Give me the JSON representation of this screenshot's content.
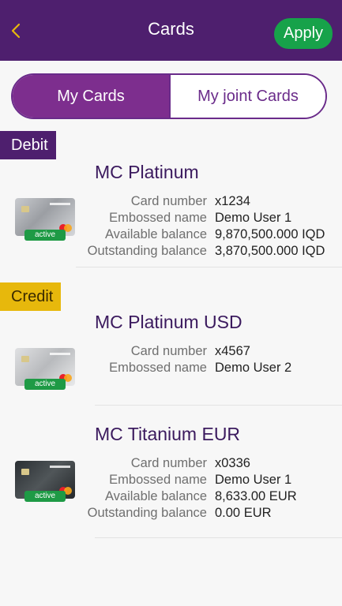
{
  "header": {
    "title": "Cards",
    "apply_label": "Apply"
  },
  "tabs": [
    {
      "label": "My Cards",
      "active": true
    },
    {
      "label": "My joint Cards",
      "active": false
    }
  ],
  "sections": {
    "debit_label": "Debit",
    "credit_label": "Credit"
  },
  "cards": [
    {
      "name": "MC Platinum",
      "status": "active",
      "fields": [
        {
          "label": "Card number",
          "value": "x1234"
        },
        {
          "label": "Embossed name",
          "value": "Demo User 1"
        },
        {
          "label": "Available balance",
          "value": "9,870,500.000 IQD"
        },
        {
          "label": "Outstanding balance",
          "value": "3,870,500.000 IQD"
        }
      ]
    },
    {
      "name": "MC Platinum USD",
      "status": "active",
      "fields": [
        {
          "label": "Card number",
          "value": "x4567"
        },
        {
          "label": "Embossed name",
          "value": "Demo User 2"
        }
      ]
    },
    {
      "name": "MC Titanium EUR",
      "status": "active",
      "fields": [
        {
          "label": "Card number",
          "value": "x0336"
        },
        {
          "label": "Embossed name",
          "value": "Demo User 1"
        },
        {
          "label": "Available balance",
          "value": "8,633.00 EUR"
        },
        {
          "label": "Outstanding balance",
          "value": "0.00 EUR"
        }
      ]
    }
  ],
  "colors": {
    "header_bg": "#4e1f6e",
    "apply_bg": "#17a24a",
    "tab_active_bg": "#7d2e8e",
    "debit_badge_bg": "#4e1f6e",
    "credit_badge_bg": "#e7b80c",
    "active_badge_bg": "#1e9a45",
    "back_icon": "#e7b80c"
  },
  "icons": {
    "back": "chevron-left-icon"
  }
}
